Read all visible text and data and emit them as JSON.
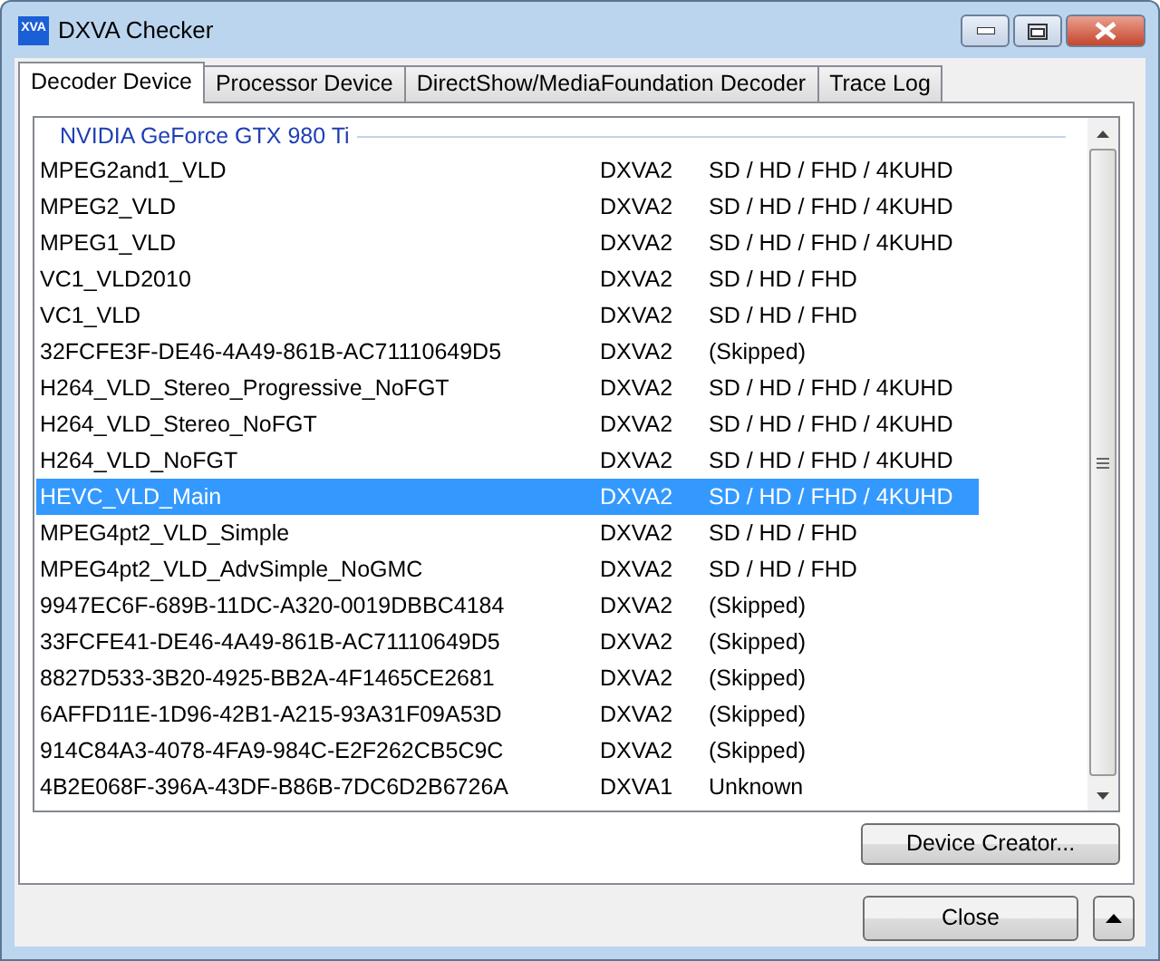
{
  "window": {
    "title": "DXVA Checker",
    "app_icon_text": "XVA"
  },
  "tabs": [
    {
      "label": "Decoder Device",
      "selected": true
    },
    {
      "label": "Processor Device",
      "selected": false
    },
    {
      "label": "DirectShow/MediaFoundation Decoder",
      "selected": false
    },
    {
      "label": "Trace Log",
      "selected": false
    }
  ],
  "device_group": "NVIDIA GeForce GTX 980 Ti",
  "decoders": [
    {
      "name": "MPEG2and1_VLD",
      "api": "DXVA2",
      "support": "SD / HD / FHD / 4KUHD",
      "selected": false
    },
    {
      "name": "MPEG2_VLD",
      "api": "DXVA2",
      "support": "SD / HD / FHD / 4KUHD",
      "selected": false
    },
    {
      "name": "MPEG1_VLD",
      "api": "DXVA2",
      "support": "SD / HD / FHD / 4KUHD",
      "selected": false
    },
    {
      "name": "VC1_VLD2010",
      "api": "DXVA2",
      "support": "SD / HD / FHD",
      "selected": false
    },
    {
      "name": "VC1_VLD",
      "api": "DXVA2",
      "support": "SD / HD / FHD",
      "selected": false
    },
    {
      "name": "32FCFE3F-DE46-4A49-861B-AC71110649D5",
      "api": "DXVA2",
      "support": "(Skipped)",
      "selected": false
    },
    {
      "name": "H264_VLD_Stereo_Progressive_NoFGT",
      "api": "DXVA2",
      "support": "SD / HD / FHD / 4KUHD",
      "selected": false
    },
    {
      "name": "H264_VLD_Stereo_NoFGT",
      "api": "DXVA2",
      "support": "SD / HD / FHD / 4KUHD",
      "selected": false
    },
    {
      "name": "H264_VLD_NoFGT",
      "api": "DXVA2",
      "support": "SD / HD / FHD / 4KUHD",
      "selected": false
    },
    {
      "name": "HEVC_VLD_Main",
      "api": "DXVA2",
      "support": "SD / HD / FHD / 4KUHD",
      "selected": true
    },
    {
      "name": "MPEG4pt2_VLD_Simple",
      "api": "DXVA2",
      "support": "SD / HD / FHD",
      "selected": false
    },
    {
      "name": "MPEG4pt2_VLD_AdvSimple_NoGMC",
      "api": "DXVA2",
      "support": "SD / HD / FHD",
      "selected": false
    },
    {
      "name": "9947EC6F-689B-11DC-A320-0019DBBC4184",
      "api": "DXVA2",
      "support": "(Skipped)",
      "selected": false
    },
    {
      "name": "33FCFE41-DE46-4A49-861B-AC71110649D5",
      "api": "DXVA2",
      "support": "(Skipped)",
      "selected": false
    },
    {
      "name": "8827D533-3B20-4925-BB2A-4F1465CE2681",
      "api": "DXVA2",
      "support": "(Skipped)",
      "selected": false
    },
    {
      "name": "6AFFD11E-1D96-42B1-A215-93A31F09A53D",
      "api": "DXVA2",
      "support": "(Skipped)",
      "selected": false
    },
    {
      "name": "914C84A3-4078-4FA9-984C-E2F262CB5C9C",
      "api": "DXVA2",
      "support": "(Skipped)",
      "selected": false
    },
    {
      "name": "4B2E068F-396A-43DF-B86B-7DC6D2B6726A",
      "api": "DXVA1",
      "support": "Unknown",
      "selected": false
    }
  ],
  "device_creator_button": "Device Creator...",
  "close_button": "Close"
}
